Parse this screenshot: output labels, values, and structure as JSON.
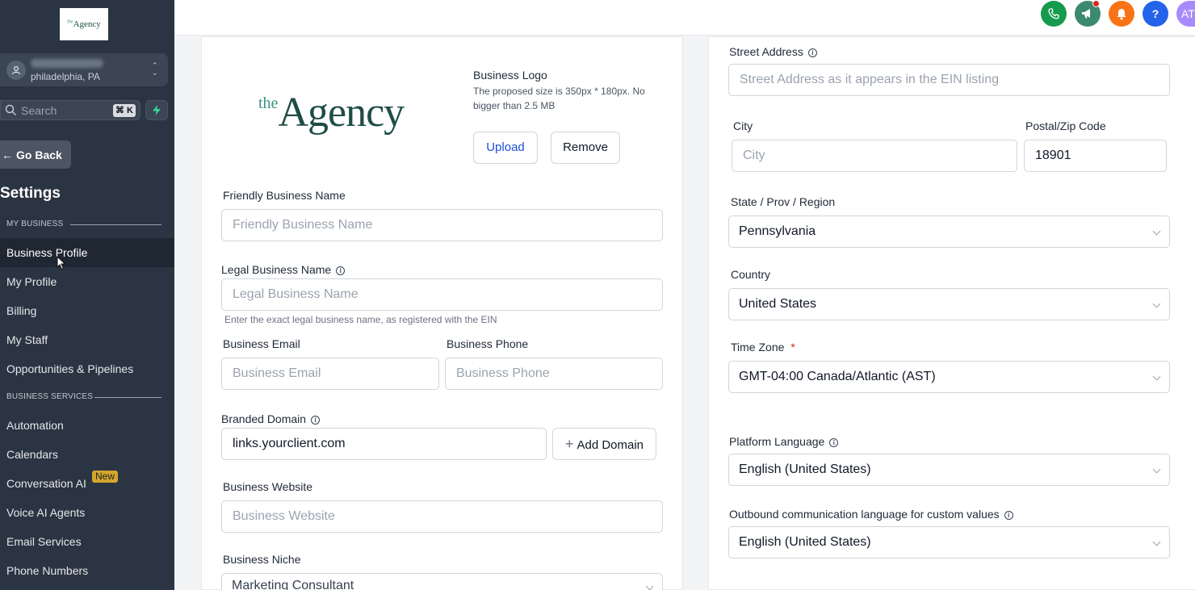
{
  "sidebar": {
    "logo_text": "Agency",
    "logo_prefix": "the",
    "location_city": "philadelphia, PA",
    "search_placeholder": "Search",
    "search_shortcut": "⌘ K",
    "go_back": "Go Back",
    "settings_title": "Settings",
    "section_my_business": "MY BUSINESS",
    "section_business_services": "BUSINESS SERVICES",
    "items": [
      {
        "label": "Business Profile",
        "active": true
      },
      {
        "label": "My Profile"
      },
      {
        "label": "Billing"
      },
      {
        "label": "My Staff"
      },
      {
        "label": "Opportunities & Pipelines"
      },
      {
        "label": "Automation"
      },
      {
        "label": "Calendars"
      },
      {
        "label": "Conversation AI"
      },
      {
        "label": "Voice AI Agents"
      },
      {
        "label": "Email Services"
      },
      {
        "label": "Phone Numbers"
      }
    ],
    "new_badge": "New"
  },
  "topbar": {
    "help_label": "?",
    "avatar_initials": "AT",
    "colors": {
      "phone": "#159a4e",
      "announce": "#3b8a6e",
      "bell": "#f97316",
      "help": "#2563eb",
      "avatar": "#a78bfa"
    }
  },
  "logo_section": {
    "logo_prefix": "the",
    "logo_text": "Agency",
    "title": "Business Logo",
    "description": "The proposed size is 350px * 180px. No bigger than 2.5 MB",
    "upload": "Upload",
    "remove": "Remove"
  },
  "form_left": {
    "friendly_name": {
      "label": "Friendly Business Name",
      "placeholder": "Friendly Business Name"
    },
    "legal_name": {
      "label": "Legal Business Name",
      "placeholder": "Legal Business Name",
      "hint": "Enter the exact legal business name, as registered with the EIN"
    },
    "email": {
      "label": "Business Email",
      "placeholder": "Business Email"
    },
    "phone": {
      "label": "Business Phone",
      "placeholder": "Business Phone"
    },
    "domain": {
      "label": "Branded Domain",
      "value": "links.yourclient.com",
      "add_button": "Add Domain"
    },
    "website": {
      "label": "Business Website",
      "placeholder": "Business Website"
    },
    "niche": {
      "label": "Business Niche",
      "value": "Marketing Consultant"
    }
  },
  "form_right": {
    "street": {
      "label": "Street Address",
      "placeholder": "Street Address as it appears in the EIN listing"
    },
    "city": {
      "label": "City",
      "placeholder": "City"
    },
    "zip": {
      "label": "Postal/Zip Code",
      "value": "18901"
    },
    "state": {
      "label": "State / Prov / Region",
      "value": "Pennsylvania"
    },
    "country": {
      "label": "Country",
      "value": "United States"
    },
    "timezone": {
      "label": "Time Zone",
      "required_mark": "*",
      "value": "GMT-04:00 Canada/Atlantic (AST)"
    },
    "platform_language": {
      "label": "Platform Language",
      "value": "English (United States)"
    },
    "outbound_language": {
      "label": "Outbound communication language for custom values",
      "value": "English (United States)"
    }
  }
}
